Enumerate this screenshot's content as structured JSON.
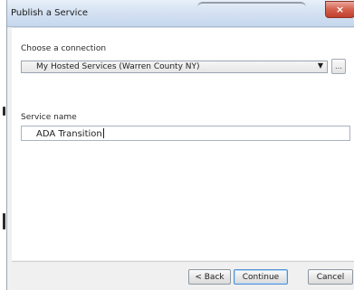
{
  "window": {
    "title": "Publish a Service",
    "close_symbol": "×"
  },
  "connection": {
    "label": "Choose a connection",
    "selected": "My Hosted Services (Warren County NY)",
    "dropdown_arrow": "▼",
    "side_button_icon": "connection-icon",
    "side_button_glyph": "…"
  },
  "service": {
    "label": "Service name",
    "value": "ADA Transition"
  },
  "buttons": {
    "back": "< Back",
    "continue": "Continue",
    "cancel": "Cancel"
  }
}
